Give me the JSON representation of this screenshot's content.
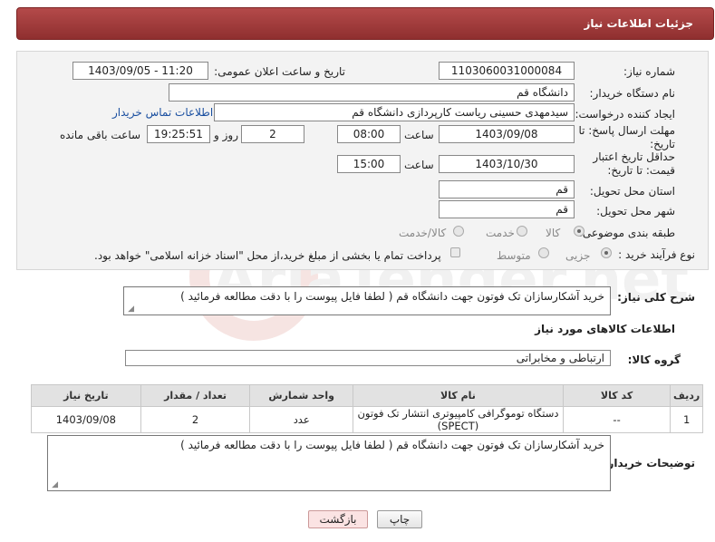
{
  "header": {
    "title": "جزئیات اطلاعات نیاز"
  },
  "form": {
    "need_number_label": "شماره نیاز:",
    "need_number": "1103060031000084",
    "announce_label": "تاریخ و ساعت اعلان عمومی:",
    "announce_value": "1403/09/05 - 11:20",
    "buyer_org_label": "نام دستگاه خریدار:",
    "buyer_org": "دانشگاه قم",
    "requester_label": "ایجاد کننده درخواست:",
    "requester": "سیدمهدی حسینی ریاست کارپردازی دانشگاه قم",
    "contact_link": "اطلاعات تماس خریدار",
    "deadline_label": "مهلت ارسال پاسخ: تا تاریخ:",
    "deadline_date": "1403/09/08",
    "time_label": "ساعت",
    "deadline_time": "08:00",
    "days": "2",
    "days_label": "روز و",
    "remaining_time": "19:25:51",
    "remaining_label": "ساعت باقی مانده",
    "validity_label": "حداقل تاریخ اعتبار قیمت: تا تاریخ:",
    "validity_date": "1403/10/30",
    "validity_time_label": "ساعت",
    "validity_time": "15:00",
    "province_label": "استان محل تحویل:",
    "province": "قم",
    "city_label": "شهر محل تحویل:",
    "city": "قم",
    "category_label": "طبقه بندی موضوعی:",
    "category_options": [
      "کالا",
      "خدمت",
      "کالا/خدمت"
    ],
    "process_label": "نوع فرآیند خرید :",
    "process_options": [
      "جزیی",
      "متوسط"
    ],
    "payment_note": "پرداخت تمام یا بخشی از مبلغ خرید،از محل \"اسناد خزانه اسلامی\" خواهد بود."
  },
  "description": {
    "label": "شرح کلی نیاز:",
    "text": "خرید آشکارسازان تک فوتون جهت دانشگاه قم ( لطفا فایل پیوست را با دقت مطالعه فرمائید )"
  },
  "goods": {
    "section_title": "اطلاعات کالاهای مورد نیاز",
    "group_label": "گروه کالا:",
    "group_value": "ارتباطی و مخابراتی",
    "columns": [
      "ردیف",
      "کد کالا",
      "نام کالا",
      "واحد شمارش",
      "تعداد / مقدار",
      "تاریخ نیاز"
    ],
    "rows": [
      [
        "1",
        "--",
        "دستگاه توموگرافی کامپیوتری انتشار تک فوتون (SPECT)",
        "عدد",
        "2",
        "1403/09/08"
      ]
    ]
  },
  "buyer_notes": {
    "label": "توضیحات خریدار:",
    "text": "خرید آشکارسازان تک فوتون جهت دانشگاه قم ( لطفا فایل پیوست را با دقت مطالعه فرمائید )"
  },
  "buttons": {
    "print": "چاپ",
    "back": "بازگشت"
  },
  "watermark_text": "AriaTender.net"
}
